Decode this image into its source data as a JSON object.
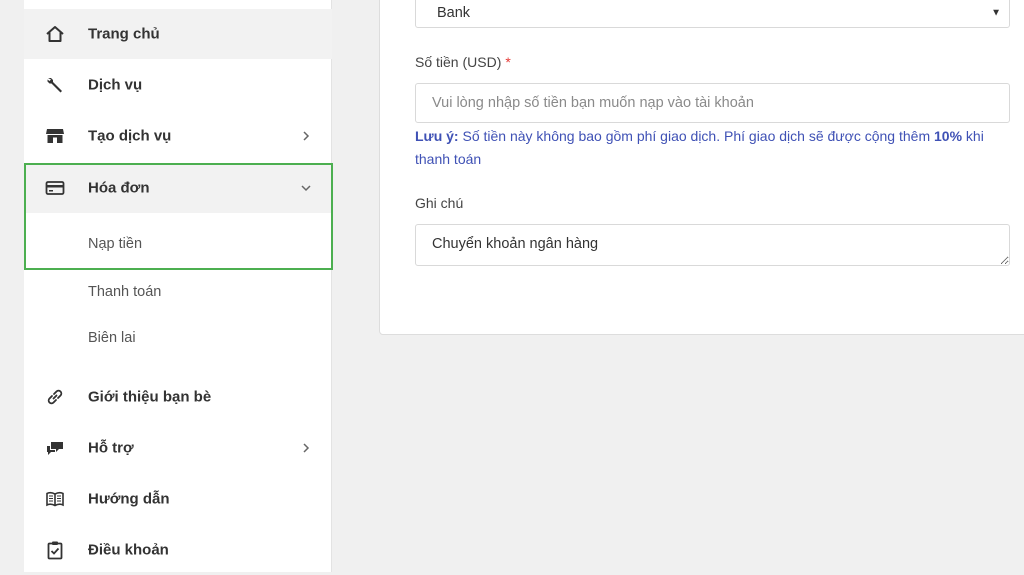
{
  "sidebar": {
    "items": [
      {
        "label": "Trang chủ",
        "icon": "home-icon"
      },
      {
        "label": "Dịch vụ",
        "icon": "wrench-icon"
      },
      {
        "label": "Tạo dịch vụ",
        "icon": "store-icon"
      },
      {
        "label": "Hóa đơn",
        "icon": "credit-card-icon"
      },
      {
        "label": "Giới thiệu bạn bè",
        "icon": "link-icon"
      },
      {
        "label": "Hỗ trợ",
        "icon": "chat-icon"
      },
      {
        "label": "Hướng dẫn",
        "icon": "book-icon"
      },
      {
        "label": "Điều khoản",
        "icon": "clipboard-check-icon"
      }
    ],
    "subitems": [
      {
        "label": "Nạp tiền"
      },
      {
        "label": "Thanh toán"
      },
      {
        "label": "Biên lai"
      }
    ]
  },
  "form": {
    "method_value": "Bank",
    "amount_label": "Số tiền (USD)",
    "amount_required_mark": "*",
    "amount_placeholder": "Vui lòng nhập số tiền bạn muốn nạp vào tài khoản",
    "note_prefix": "Lưu ý:",
    "note_text": " Số tiền này không bao gồm phí giao dịch. Phí giao dịch sẽ được cộng thêm ",
    "note_fee": "10%",
    "note_suffix": " khi thanh toán",
    "memo_label": "Ghi chú",
    "memo_value": "Chuyển khoản ngân hàng"
  },
  "colors": {
    "highlight": "#4caf50",
    "note_text": "#3f51b5",
    "required": "#e53935"
  }
}
